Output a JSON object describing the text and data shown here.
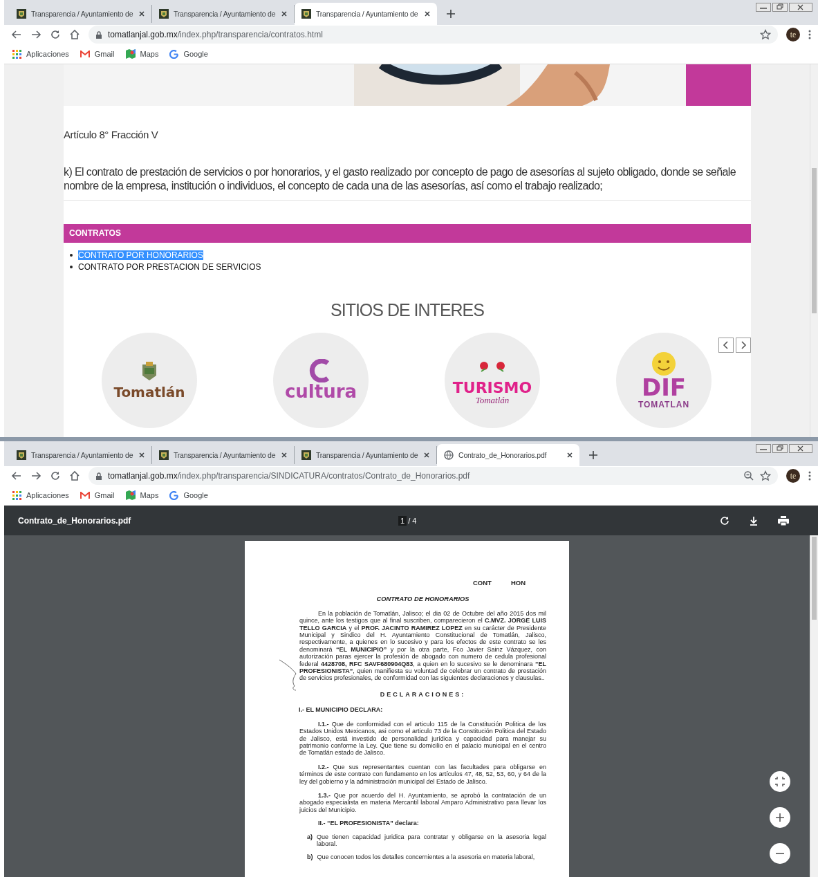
{
  "windows": [
    {
      "tabs": [
        {
          "title": "Transparencia / Ayuntamiento de",
          "kind": "site",
          "selected": false
        },
        {
          "title": "Transparencia / Ayuntamiento de",
          "kind": "site",
          "selected": false
        },
        {
          "title": "Transparencia / Ayuntamiento de",
          "kind": "site",
          "selected": true
        }
      ],
      "url": {
        "host": "tomatlanjal.gob.mx",
        "path": "/index.php/transparencia/contratos.html"
      },
      "zoom_icon": false,
      "avatar": "te",
      "bookmarks": [
        {
          "label": "Aplicaciones",
          "kind": "apps"
        },
        {
          "label": "Gmail",
          "kind": "gmail"
        },
        {
          "label": "Maps",
          "kind": "maps"
        },
        {
          "label": "Google",
          "kind": "google"
        }
      ],
      "content": {
        "kind": "web",
        "article": "Artículo 8° Fracción V",
        "paragraph": "k) El contrato de prestación de servicios o por honorarios, y el gasto realizado por concepto de pago de asesorías al sujeto obligado, donde se señale nombre de la empresa, institución o individuos, el concepto de cada una de las asesorías, así como el trabajo realizado;",
        "section": "CONTRATOS",
        "links": [
          {
            "label": "CONTRATO POR HONORARIOS",
            "highlighted": true
          },
          {
            "label": "CONTRATO POR PRESTACION DE SERVICIOS",
            "highlighted": false
          }
        ],
        "sites_title": "SITIOS DE INTERES",
        "sites": [
          {
            "kind": "tomatlan",
            "words": [
              "Tomatlán"
            ]
          },
          {
            "kind": "cultura",
            "words": [
              "cultura"
            ]
          },
          {
            "kind": "turismo",
            "words": [
              "TURISMO",
              "Tomatlán"
            ]
          },
          {
            "kind": "dif",
            "words": [
              "DIF",
              "TOMATLAN"
            ]
          }
        ]
      }
    },
    {
      "tabs": [
        {
          "title": "Transparencia / Ayuntamiento de",
          "kind": "site",
          "selected": false
        },
        {
          "title": "Transparencia / Ayuntamiento de",
          "kind": "site",
          "selected": false
        },
        {
          "title": "Transparencia / Ayuntamiento de",
          "kind": "site",
          "selected": false
        },
        {
          "title": "Contrato_de_Honorarios.pdf",
          "kind": "file",
          "selected": true
        }
      ],
      "url": {
        "host": "tomatlanjal.gob.mx",
        "path": "/index.php/transparencia/SINDICATURA/contratos/Contrato_de_Honorarios.pdf"
      },
      "zoom_icon": true,
      "avatar": "te",
      "bookmarks": [
        {
          "label": "Aplicaciones",
          "kind": "apps"
        },
        {
          "label": "Gmail",
          "kind": "gmail"
        },
        {
          "label": "Maps",
          "kind": "maps"
        },
        {
          "label": "Google",
          "kind": "google"
        }
      ],
      "content": {
        "kind": "pdf",
        "file": "Contrato_de_Honorarios.pdf",
        "page": "1",
        "pages": "/ 4",
        "doc": [
          {
            "kind": "header",
            "texts": [
              "CONT",
              "HON"
            ]
          },
          {
            "kind": "title",
            "text": "CONTRATO DE HONORARIOS"
          },
          {
            "kind": "para",
            "text": "En la población de Tomatlán, Jalisco; el dia 02 de Octubre  del año 2015 dos mil quince, ante los testigos que al final suscriben, comparecieron el **C.MVZ. JORGE LUIS TELLO GARCIA** y el **PROF. JACINTO RAMIREZ LOPEZ** en su carácter de Presidente Municipal y Sindico del H. Ayuntamiento Constitucional de Tomatlán, Jalisco, respectivamente, a quienes en lo sucesivo y para los efectos de este contrato se les denominará **“EL MUNICIPIO”** y por la otra parte, Fco Javier Sainz Vázquez, con autorización paras ejercer la profesión de abogado con numero de cedula profesional federal **4428708, RFC SAVF680904Q83**, a quien en lo sucesivo se le denominara **“EL PROFESIONISTA”**, quien manifiesta su voluntad de celebrar un contrato de prestación de servicios profesionales, de conformidad con las siguientes declaraciones y clausulas.."
          },
          {
            "kind": "spaced",
            "text": "DECLARACIONES:"
          },
          {
            "kind": "heading",
            "text": "I.- EL MUNICIPIO DECLARA:"
          },
          {
            "kind": "para",
            "text": "**I.1.-** Que de conformidad con el articulo 115 de la Constitución Politica de los Estados Unidos Mexicanos, asi como el articulo 73 de la Constitución Politica del Estado de Jalisco, está investido de personalidad jurídica y capacidad para manejar su patrimonio conforme la Ley. Que tiene su domicilio en el palacio municipal en el centro de Tomatlán estado de Jalisco."
          },
          {
            "kind": "para",
            "text": "**I.2.-** Que sus representantes cuentan con las facultades para obligarse en términos de este contrato con fundamento en los artículos 47, 48, 52, 53, 60, y 64  de la ley del gobierno y la administración municipal del Estado de Jalisco."
          },
          {
            "kind": "para",
            "text": "**1.3.-** Que por acuerdo del H. Ayuntamiento, se aprobó la contratación de un abogado especialista en materia Mercantil  laboral Amparo Administrativo    para llevar los juicios del Municipio."
          },
          {
            "kind": "subheading",
            "text": "II.- “EL PROFESIONISTA” declara:"
          },
          {
            "kind": "item",
            "mark": "a)",
            "text": "Que tienen capacidad juridica para contratar y obligarse en la asesoria legal laboral."
          },
          {
            "kind": "item",
            "mark": "b)",
            "text": "Que conocen todos los detalles concernientes a la asesoria en materia laboral,"
          }
        ]
      }
    }
  ]
}
